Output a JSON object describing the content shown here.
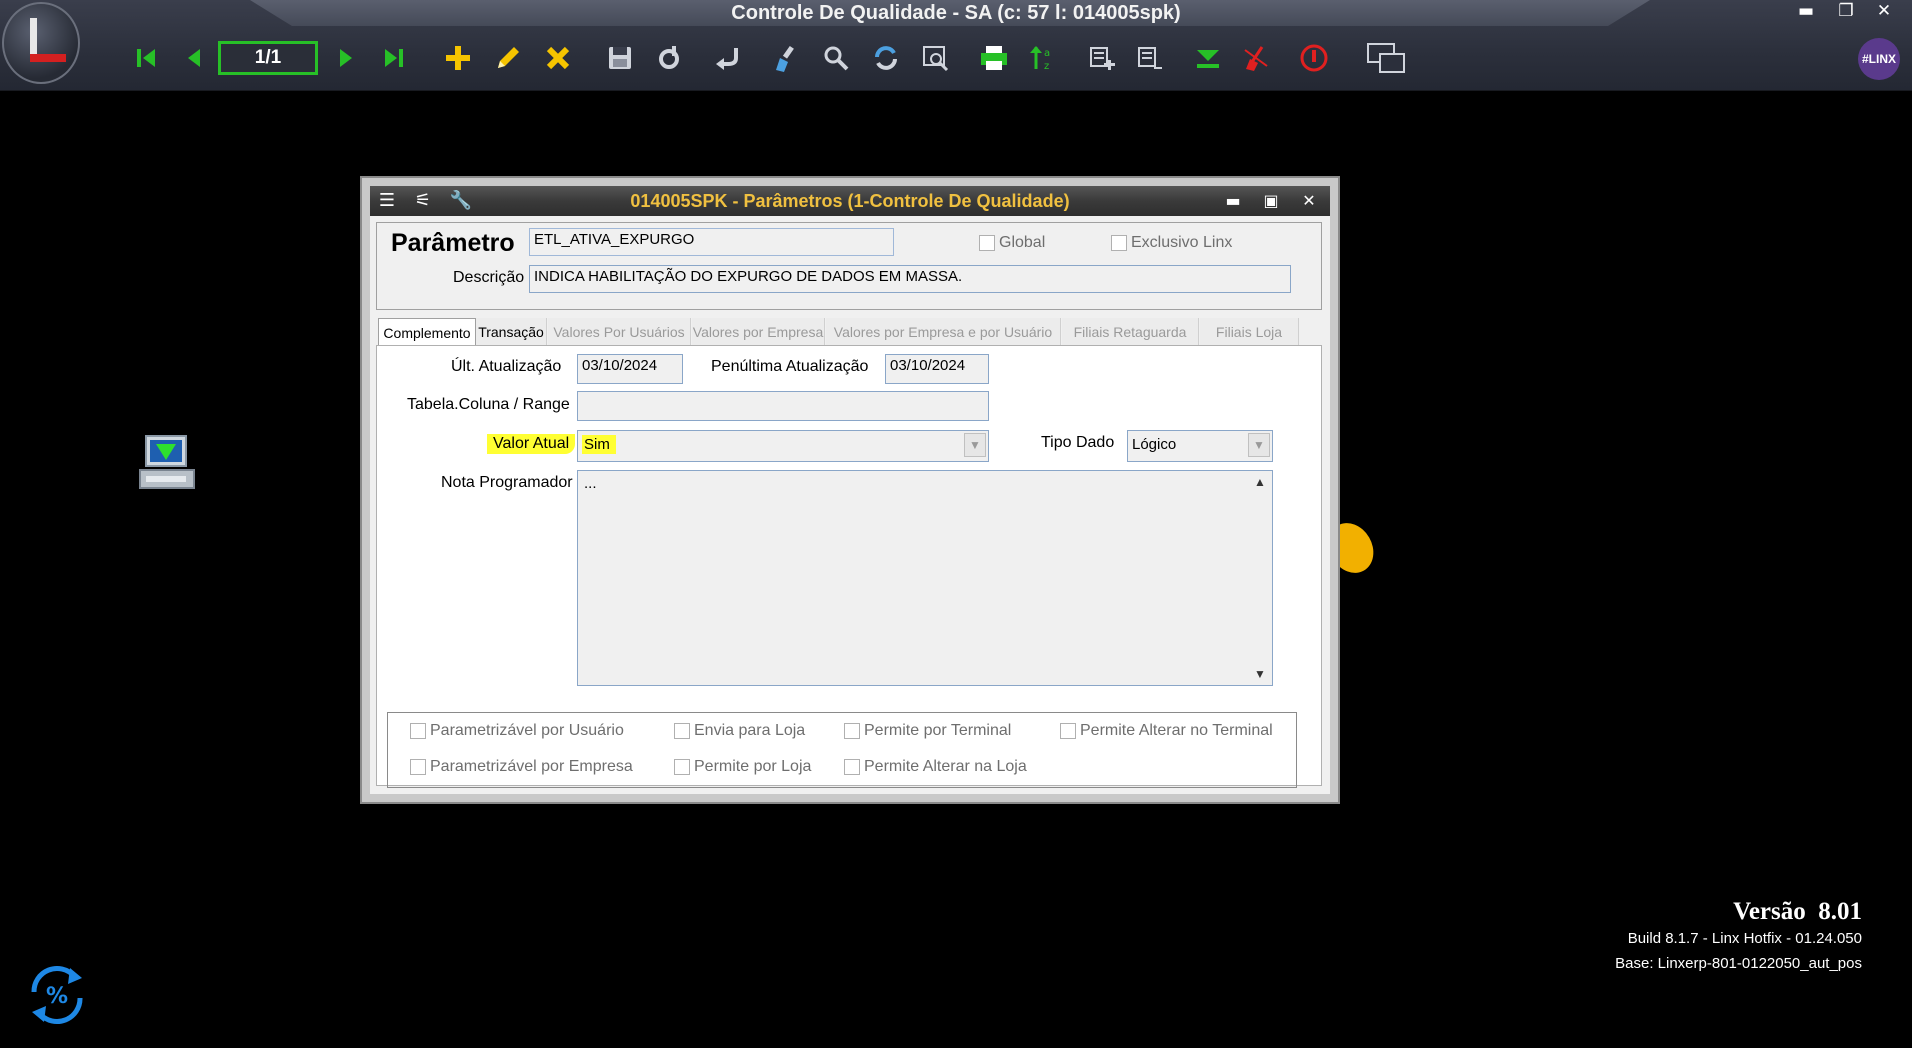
{
  "app": {
    "title": "Controle De Qualidade - SA (c: 57 l: 014005spk)",
    "record_position": "1/1",
    "badge": "#LINX",
    "window_controls": {
      "minimize": "▬",
      "restore": "❐",
      "close": "✕"
    }
  },
  "toolbar": {
    "icons": [
      "first-record-icon",
      "previous-record-icon",
      "next-record-icon",
      "last-record-icon",
      "add-icon",
      "edit-pencil-icon",
      "delete-icon",
      "save-icon",
      "gear-refresh-icon",
      "undo-icon",
      "clear-brush-icon",
      "search-icon",
      "refresh-icon",
      "search-window-icon",
      "print-icon",
      "sort-icon",
      "list-add-icon",
      "list-icon",
      "expand-down-icon",
      "cancel-broom-icon",
      "stop-icon",
      "multi-window-icon"
    ]
  },
  "dialog": {
    "title": "014005SPK - Parâmetros (1-Controle De Qualidade)",
    "controls": {
      "minimize": "▬",
      "maximize": "▣",
      "close": "✕"
    },
    "param_label": "Parâmetro",
    "param_value": "ETL_ATIVA_EXPURGO",
    "global_label": "Global",
    "exclusivo_label": "Exclusivo Linx",
    "descricao_label": "Descrição",
    "descricao_value": "INDICA HABILITAÇÃO DO EXPURGO DE DADOS EM MASSA.",
    "tabs": [
      {
        "label": "Complemento",
        "state": "active"
      },
      {
        "label": "Transação",
        "state": "normal"
      },
      {
        "label": "Valores Por Usuários",
        "state": "disabled"
      },
      {
        "label": "Valores por Empresa",
        "state": "disabled"
      },
      {
        "label": "Valores por Empresa e por Usuário",
        "state": "disabled"
      },
      {
        "label": "Filiais Retaguarda",
        "state": "disabled"
      },
      {
        "label": "Filiais Loja",
        "state": "disabled"
      }
    ],
    "ult_atualizacao_label": "Últ. Atualização",
    "ult_atualizacao_value": "03/10/2024",
    "penultima_label": "Penúltima Atualização",
    "penultima_value": "03/10/2024",
    "tabela_label": "Tabela.Coluna / Range",
    "tabela_value": "",
    "valor_atual_label": "Valor Atual",
    "valor_atual_value": "Sim",
    "tipo_dado_label": "Tipo Dado",
    "tipo_dado_value": "Lógico",
    "nota_label": "Nota Programador",
    "nota_value": "...",
    "flags": [
      "Parametrizável por Usuário",
      "Envia para Loja",
      "Permite por Terminal",
      "Permite Alterar no Terminal",
      "Parametrizável por Empresa",
      "Permite por Loja",
      "Permite Alterar na Loja"
    ]
  },
  "version": {
    "title": "Versão  8.01",
    "build": "Build 8.1.7 - Linx Hotfix - 01.24.050",
    "base": "Base: Linxerp-801-0122050_aut_pos"
  },
  "colors": {
    "highlight": "#ffff33",
    "dialog_title_text": "#f0c040",
    "toolbar_green": "#27c027",
    "toolbar_yellow": "#f5c400"
  }
}
